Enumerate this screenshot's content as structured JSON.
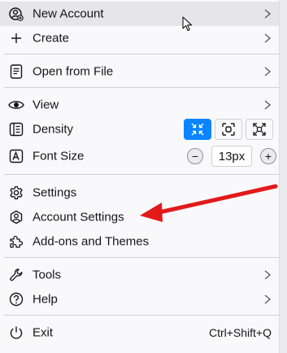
{
  "menu": {
    "new_account": {
      "label": "New Account",
      "icon": "new-account-icon"
    },
    "create": {
      "label": "Create",
      "icon": "plus-icon"
    },
    "open_file": {
      "label": "Open from File",
      "icon": "file-icon"
    },
    "view": {
      "label": "View",
      "icon": "eye-icon"
    },
    "density": {
      "label": "Density",
      "icon": "density-icon",
      "options": [
        "compact",
        "normal",
        "touch"
      ],
      "selected": "compact"
    },
    "font_size": {
      "label": "Font Size",
      "icon": "font-size-icon",
      "value": "13px",
      "decrease": "−",
      "increase": "+"
    },
    "settings": {
      "label": "Settings",
      "icon": "gear-icon"
    },
    "account_settings": {
      "label": "Account Settings",
      "icon": "account-settings-icon"
    },
    "addons": {
      "label": "Add-ons and Themes",
      "icon": "puzzle-icon"
    },
    "tools": {
      "label": "Tools",
      "icon": "wrench-icon"
    },
    "help": {
      "label": "Help",
      "icon": "help-icon"
    },
    "exit": {
      "label": "Exit",
      "icon": "power-icon",
      "shortcut": "Ctrl+Shift+Q"
    }
  },
  "colors": {
    "accent": "#0a84ff",
    "annotation_arrow": "#e21a1a",
    "hover": "#e6e6ea"
  }
}
